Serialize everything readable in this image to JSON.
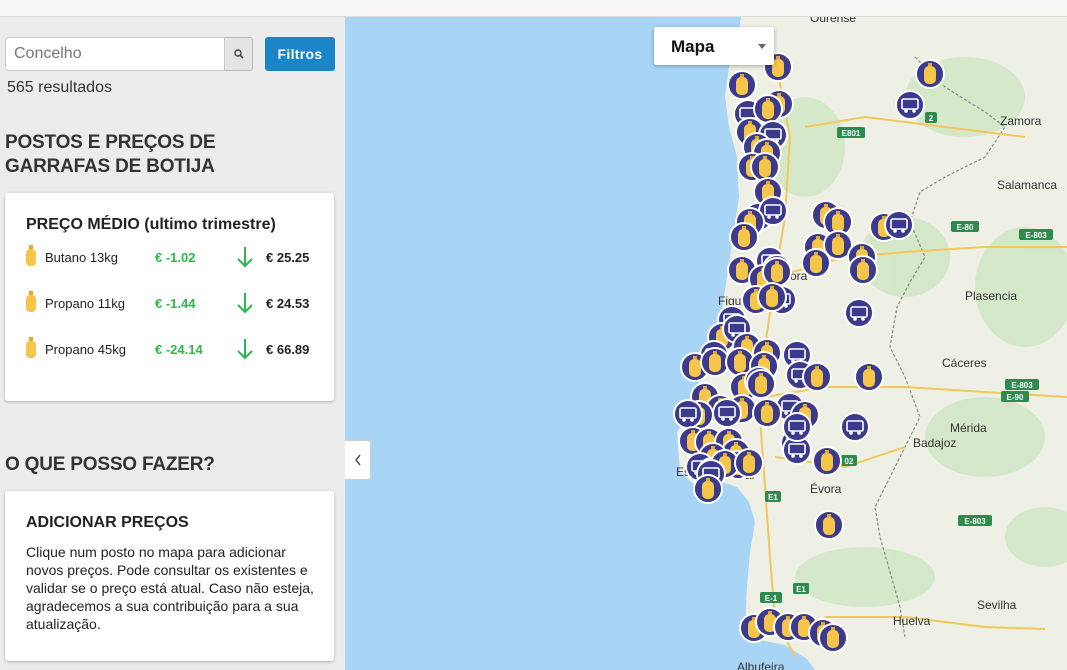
{
  "search": {
    "placeholder": "Concelho"
  },
  "toolbar": {
    "filters_label": "Filtros"
  },
  "results_count": "565 resultados",
  "section_title": "POSTOS E PREÇOS DE GARRAFAS DE BOTIJA",
  "average_card": {
    "title": "PREÇO MÉDIO (ultimo trimestre)",
    "rows": [
      {
        "name": "Butano 13kg",
        "delta": "€ -1.02",
        "price": "€ 25.25"
      },
      {
        "name": "Propano 11kg",
        "delta": "€ -1.44",
        "price": "€ 24.53"
      },
      {
        "name": "Propano 45kg",
        "delta": "€ -24.14",
        "price": "€ 66.89"
      }
    ]
  },
  "help_section_title": "O QUE POSSO FAZER?",
  "help_card": {
    "title": "ADICIONAR PREÇOS",
    "body": "Clique num posto no mapa para adicionar novos preços. Pode consultar os existentes e validar se o preço está atual. Caso não esteja, agradecemos a sua contribuição para a sua atualização."
  },
  "map": {
    "type_label": "Mapa",
    "places": [
      "Ourense",
      "Zamora",
      "Salamanca",
      "Plasencia",
      "Cáceres",
      "Mérida",
      "Badajoz",
      "Évora",
      "Huelva",
      "Sevilha",
      "Albufeira",
      "Figu",
      "Esto",
      "ora",
      "al"
    ],
    "roads": [
      "E801",
      "E-80",
      "E-803",
      "E-803",
      "E-90",
      "E-803",
      "E1",
      "E1",
      "E-1",
      "2",
      "02"
    ]
  },
  "colors": {
    "accent": "#1a86c9",
    "decrease": "#2db84b",
    "marker_ring": "#3c3a8c",
    "bottle": "#f6c64a",
    "sea": "#a8d4f5",
    "land": "#eef0e6"
  },
  "icons": {
    "search": "magnifier-icon",
    "bottle": "gas-bottle-icon",
    "truck": "truck-icon",
    "trend": "arrow-down-icon",
    "collapse": "chevron-left-icon"
  }
}
